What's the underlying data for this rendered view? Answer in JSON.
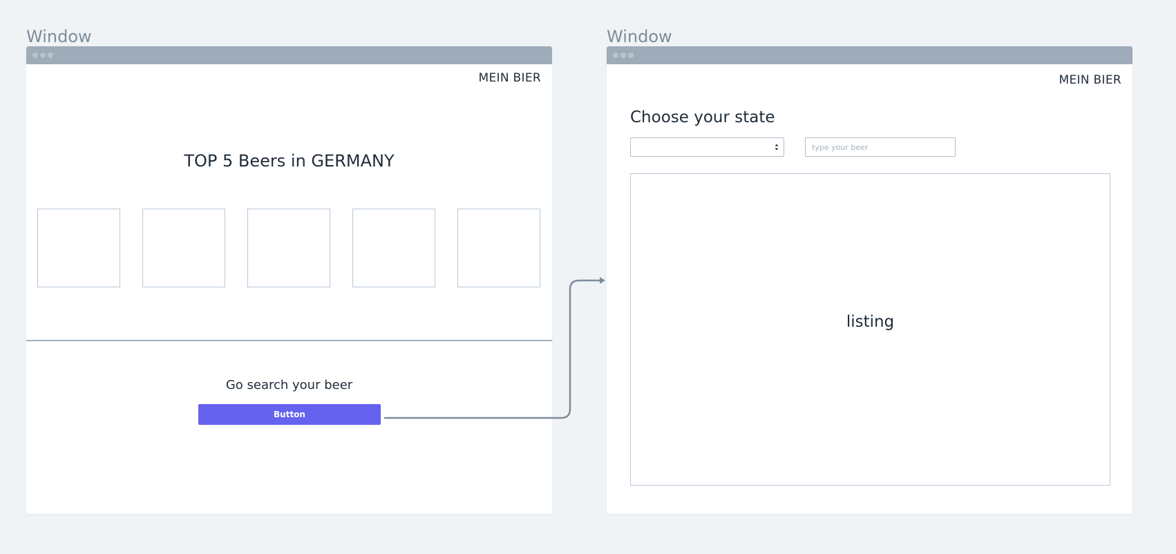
{
  "window_left": {
    "label": "Window",
    "brand": "MEIN BIER",
    "hero_title": "TOP 5 Beers in GERMANY",
    "beer_slot_count": 5,
    "cta_text": "Go search your beer",
    "button_label": "Button"
  },
  "window_right": {
    "label": "Window",
    "brand": "MEIN BIER",
    "section_title": "Choose your state",
    "state_select_value": "",
    "search_placeholder": "type your beer",
    "listing_label": "listing"
  },
  "colors": {
    "background": "#eff3f6",
    "titlebar": "#9eabb8",
    "accent_button": "#6562f0",
    "connector": "#7d8c9a",
    "box_border": "#b7c7d8"
  },
  "connector": {
    "from": "window_left.button",
    "to": "window_right"
  }
}
